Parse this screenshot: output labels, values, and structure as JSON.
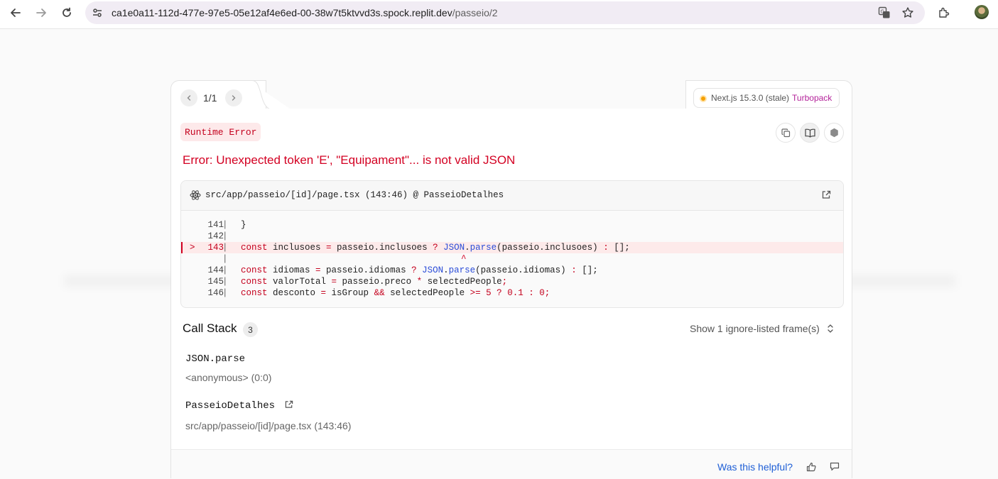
{
  "browser": {
    "url_host": "ca1e0a11-112d-477e-97e5-05e12af4e6ed-00-38w7t5ktvvd3s.spock.replit.dev",
    "url_path": "/passeio/2"
  },
  "overlay": {
    "pager": "1/1",
    "version": "Next.js 15.3.0 (stale)",
    "bundler": "Turbopack",
    "badge": "Runtime Error",
    "error_message": "Error: Unexpected token 'E', \"Equipament\"... is not valid JSON",
    "code_frame": {
      "file": "src/app/passeio/[id]/page.tsx (143:46) @ PasseioDetalhes",
      "lines": [
        {
          "num": "141",
          "marker": "",
          "code": "}"
        },
        {
          "num": "142",
          "marker": "",
          "code": ""
        },
        {
          "num": "143",
          "marker": ">",
          "code": "const inclusoes = passeio.inclusoes ? JSON.parse(passeio.inclusoes) : [];"
        },
        {
          "num": "",
          "marker": "",
          "code": "^"
        },
        {
          "num": "144",
          "marker": "",
          "code": "const idiomas = passeio.idiomas ? JSON.parse(passeio.idiomas) : [];"
        },
        {
          "num": "145",
          "marker": "",
          "code": "const valorTotal = passeio.preco * selectedPeople;"
        },
        {
          "num": "146",
          "marker": "",
          "code": "const desconto = isGroup && selectedPeople >= 5 ? 0.1 : 0;"
        }
      ]
    },
    "call_stack": {
      "title": "Call Stack",
      "count": "3",
      "ignore_toggle": "Show 1 ignore-listed frame(s)",
      "frames": [
        {
          "name": "JSON.parse",
          "location": "<anonymous> (0:0)"
        },
        {
          "name": "PasseioDetalhes",
          "location": "src/app/passeio/[id]/page.tsx (143:46)"
        }
      ]
    },
    "footer": {
      "helpful": "Was this helpful?"
    }
  },
  "colors": {
    "error": "#d30022",
    "badge_bg": "#fde9ea",
    "link": "#1f5fd6",
    "turbopack": "#b4239a",
    "status_dot": "#f5a000"
  }
}
